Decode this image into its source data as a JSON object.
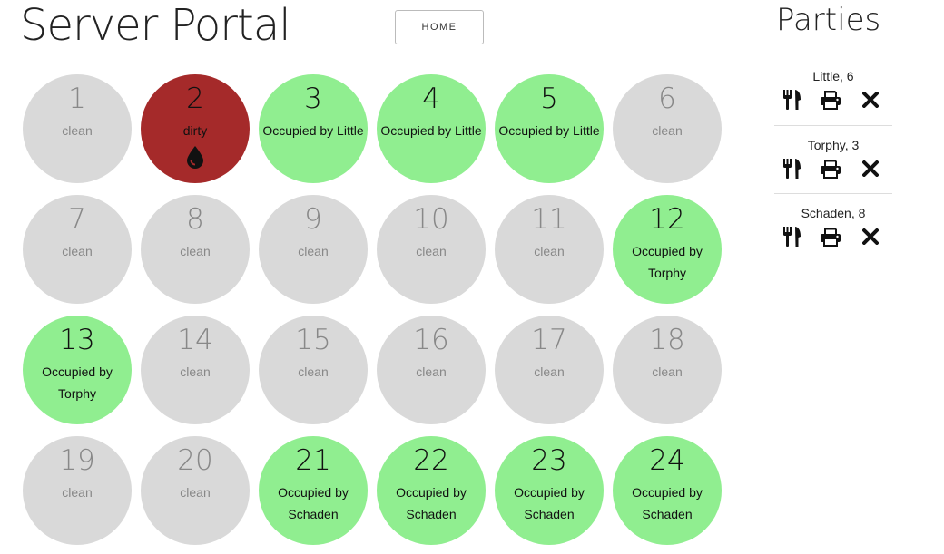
{
  "app_title": "Server Portal",
  "home_button": "HOME",
  "sidebar": {
    "title": "Parties",
    "parties": [
      {
        "label": "Little, 6"
      },
      {
        "label": "Torphy, 3"
      },
      {
        "label": "Schaden, 8"
      }
    ]
  },
  "tables": [
    {
      "number": "1",
      "status": "clean"
    },
    {
      "number": "2",
      "status": "dirty",
      "icon": "water-drop-icon"
    },
    {
      "number": "3",
      "status": "Occupied by Little"
    },
    {
      "number": "4",
      "status": "Occupied by Little"
    },
    {
      "number": "5",
      "status": "Occupied by Little"
    },
    {
      "number": "6",
      "status": "clean"
    },
    {
      "number": "7",
      "status": "clean"
    },
    {
      "number": "8",
      "status": "clean"
    },
    {
      "number": "9",
      "status": "clean"
    },
    {
      "number": "10",
      "status": "clean"
    },
    {
      "number": "11",
      "status": "clean"
    },
    {
      "number": "12",
      "status": "Occupied by Torphy"
    },
    {
      "number": "13",
      "status": "Occupied by Torphy"
    },
    {
      "number": "14",
      "status": "clean"
    },
    {
      "number": "15",
      "status": "clean"
    },
    {
      "number": "16",
      "status": "clean"
    },
    {
      "number": "17",
      "status": "clean"
    },
    {
      "number": "18",
      "status": "clean"
    },
    {
      "number": "19",
      "status": "clean"
    },
    {
      "number": "20",
      "status": "clean"
    },
    {
      "number": "21",
      "status": "Occupied by Schaden"
    },
    {
      "number": "22",
      "status": "Occupied by Schaden"
    },
    {
      "number": "23",
      "status": "Occupied by Schaden"
    },
    {
      "number": "24",
      "status": "Occupied by Schaden"
    }
  ],
  "colors": {
    "clean": "#d9d9d9",
    "occupied": "#90ee90",
    "dirty": "#a52a2a"
  }
}
